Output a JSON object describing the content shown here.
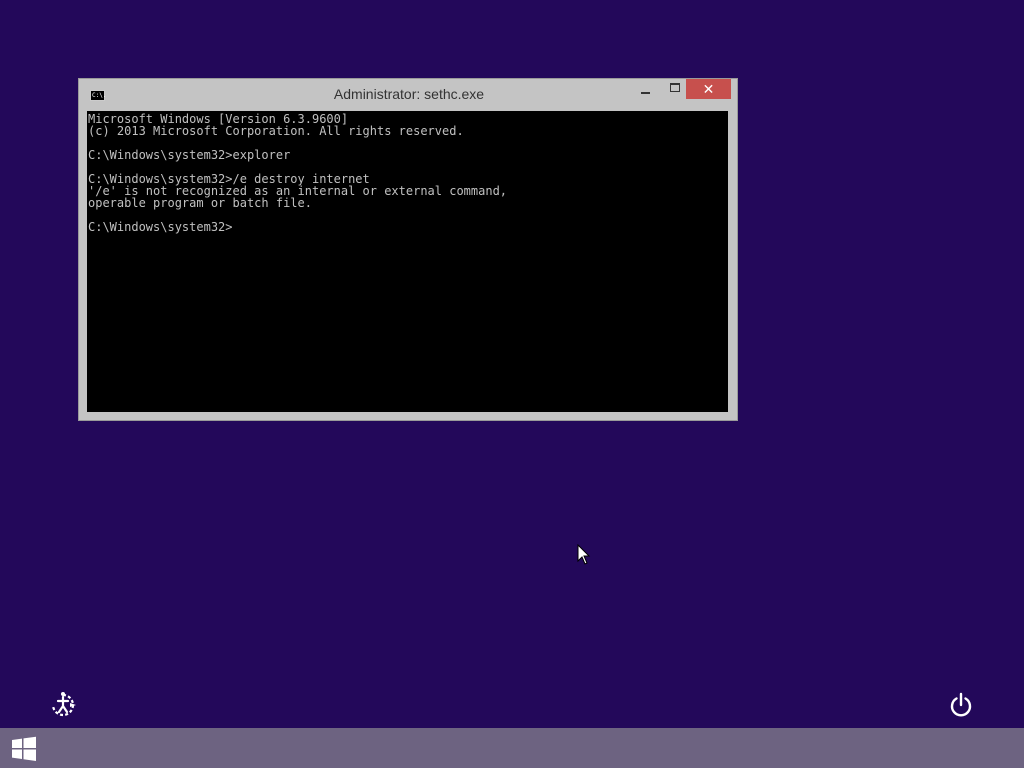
{
  "colors": {
    "desktop_background": "#23085a",
    "window_frame": "#c4c4c4",
    "close_button": "#c7504d",
    "console_background": "#000000",
    "console_text": "#c0c0c0",
    "taskbar": "#6d6381"
  },
  "window": {
    "title": "Administrator: sethc.exe",
    "app_icon": "console-app-icon",
    "app_icon_text": "C:\\.",
    "close_glyph": "✕"
  },
  "console": {
    "lines": [
      "Microsoft Windows [Version 6.3.9600]",
      "(c) 2013 Microsoft Corporation. All rights reserved.",
      "",
      "C:\\Windows\\system32>explorer",
      "",
      "C:\\Windows\\system32>/e destroy internet",
      "'/e' is not recognized as an internal or external command,",
      "operable program or batch file.",
      "",
      "C:\\Windows\\system32>"
    ]
  },
  "desktop": {
    "ease_of_access_icon": "ease-of-access-icon",
    "power_icon": "power-icon",
    "cursor_icon": "mouse-pointer-icon"
  },
  "taskbar": {
    "start_icon": "windows-logo-icon"
  }
}
